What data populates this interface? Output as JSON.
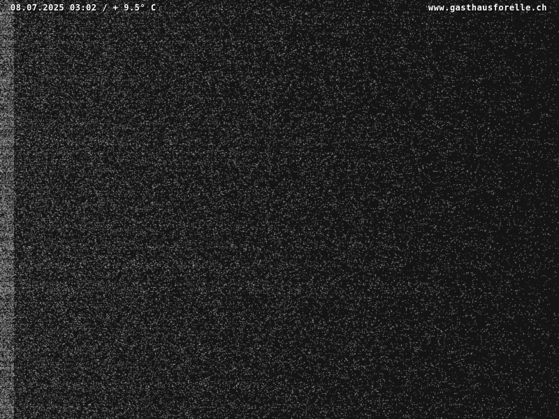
{
  "overlay": {
    "timestamp_line": "08.07.2025 03:02 / + 9.5° C",
    "site_url": "www.gasthausforelle.ch"
  },
  "scene": {
    "description_colors": {
      "background": "#141414",
      "noise": "#9a9a9a"
    }
  }
}
